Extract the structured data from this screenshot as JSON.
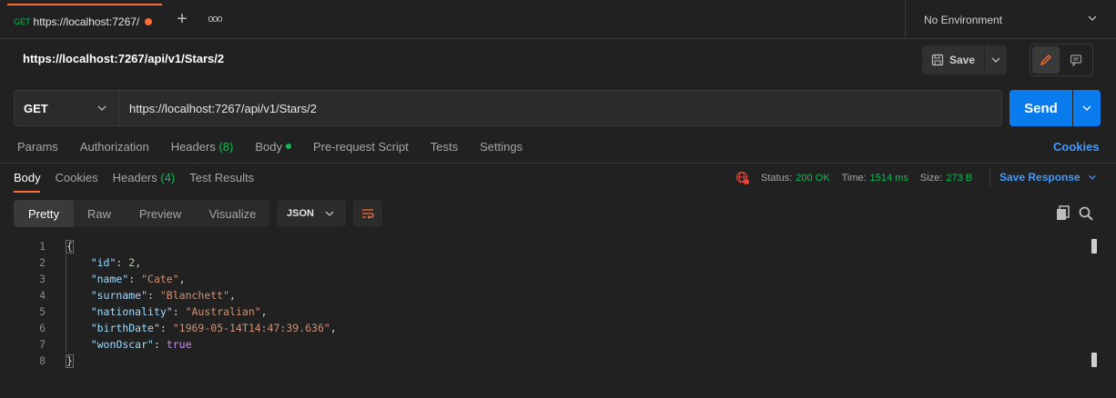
{
  "tab": {
    "method": "GET",
    "title": "https://localhost:7267/"
  },
  "environment": {
    "label": "No Environment"
  },
  "request": {
    "title": "https://localhost:7267/api/v1/Stars/2",
    "save_label": "Save",
    "method": "GET",
    "url": "https://localhost:7267/api/v1/Stars/2",
    "send_label": "Send"
  },
  "request_tabs": {
    "params": "Params",
    "authorization": "Authorization",
    "headers": "Headers",
    "headers_count": "(8)",
    "body": "Body",
    "prerequest": "Pre-request Script",
    "tests": "Tests",
    "settings": "Settings",
    "cookies": "Cookies"
  },
  "response_tabs": {
    "body": "Body",
    "cookies": "Cookies",
    "headers": "Headers",
    "headers_count": "(4)",
    "test_results": "Test Results"
  },
  "status": {
    "status_label": "Status:",
    "status_value": "200 OK",
    "time_label": "Time:",
    "time_value": "1514 ms",
    "size_label": "Size:",
    "size_value": "273 B",
    "save_response": "Save Response"
  },
  "view": {
    "pretty": "Pretty",
    "raw": "Raw",
    "preview": "Preview",
    "visualize": "Visualize",
    "format": "JSON"
  },
  "response_body": {
    "line_numbers": [
      "1",
      "2",
      "3",
      "4",
      "5",
      "6",
      "7",
      "8"
    ],
    "id_key": "\"id\"",
    "id_val": "2",
    "name_key": "\"name\"",
    "name_val": "\"Cate\"",
    "surname_key": "\"surname\"",
    "surname_val": "\"Blanchett\"",
    "nationality_key": "\"nationality\"",
    "nationality_val": "\"Australian\"",
    "birthDate_key": "\"birthDate\"",
    "birthDate_val": "\"1969-05-14T14:47:39.636\"",
    "wonOscar_key": "\"wonOscar\"",
    "wonOscar_val": "true",
    "open_brace": "{",
    "close_brace": "}"
  },
  "colors": {
    "accent_orange": "#ff6c37",
    "send_blue": "#097bed",
    "link_blue": "#3f9bff",
    "success_green": "#0cbb52",
    "background": "#212121"
  }
}
